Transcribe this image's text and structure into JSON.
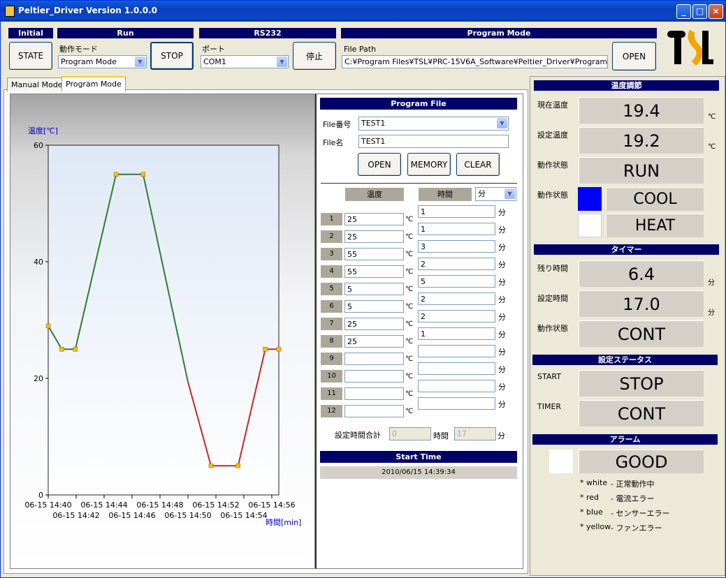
{
  "window": {
    "title": "Peltier_Driver Version 1.0.0.0",
    "min": "_",
    "max": "□",
    "close": "×"
  },
  "initial": {
    "header": "Initial",
    "state_btn": "STATE"
  },
  "run": {
    "header": "Run",
    "mode_label": "動作モード",
    "mode_value": "Program Mode",
    "stop_btn": "STOP"
  },
  "rs232": {
    "header": "RS232",
    "port_label": "ポート",
    "port_value": "COM1",
    "stop_btn": "停止"
  },
  "program_mode": {
    "header": "Program Mode",
    "file_path_label": "File Path",
    "file_path_value": "C:¥Program Files¥TSL¥PRC-15V6A_Software¥Peltier_Driver¥Program Mode",
    "open_btn": "OPEN"
  },
  "logo": "TSL",
  "tabs": [
    "Manual Mode",
    "Program Mode"
  ],
  "program_file": {
    "header": "Program File",
    "file_no_label": "File番号",
    "file_no_value": "TEST1",
    "file_name_label": "File名",
    "file_name_value": "TEST1",
    "open_btn": "OPEN",
    "memory_btn": "MEMORY",
    "clear_btn": "CLEAR",
    "temp_header": "温度",
    "time_header": "時間",
    "time_unit_select": "分",
    "temp_unit": "℃",
    "time_unit": "分",
    "rows": [
      {
        "no": "1",
        "temp": "25"
      },
      {
        "no": "2",
        "temp": "25"
      },
      {
        "no": "3",
        "temp": "55"
      },
      {
        "no": "4",
        "temp": "55"
      },
      {
        "no": "5",
        "temp": "5"
      },
      {
        "no": "6",
        "temp": "5"
      },
      {
        "no": "7",
        "temp": "25"
      },
      {
        "no": "8",
        "temp": "25"
      },
      {
        "no": "9",
        "temp": ""
      },
      {
        "no": "10",
        "temp": ""
      },
      {
        "no": "11",
        "temp": ""
      },
      {
        "no": "12",
        "temp": ""
      }
    ],
    "times": [
      "1",
      "1",
      "3",
      "2",
      "5",
      "2",
      "2",
      "1",
      "",
      "",
      "",
      ""
    ],
    "total_label": "設定時間合計",
    "total_hours": "0",
    "hours_unit": "時間",
    "total_minutes": "17",
    "minutes_unit": "分",
    "start_time_header": "Start Time",
    "start_time_value": "2010/06/15 14:39:34"
  },
  "temp_control": {
    "header": "温度調節",
    "current_label": "現在温度",
    "current_value": "19.4",
    "set_label": "設定温度",
    "set_value": "19.2",
    "unit": "℃",
    "status_label": "動作状態",
    "status_value": "RUN",
    "mode_label": "動作状態",
    "cool_label": "COOL",
    "heat_label": "HEAT",
    "cool_color": "#0000ff",
    "heat_color": "#ffffff"
  },
  "timer": {
    "header": "タイマー",
    "remaining_label": "残り時間",
    "remaining_value": "6.4",
    "set_label": "設定時間",
    "set_value": "17.0",
    "unit": "分",
    "status_label": "動作状態",
    "status_value": "CONT"
  },
  "set_status": {
    "header": "設定ステータス",
    "start_label": "START",
    "start_value": "STOP",
    "timer_label": "TIMER",
    "timer_value": "CONT"
  },
  "alarm": {
    "header": "アラーム",
    "value": "GOOD",
    "indicator_color": "#ffffff",
    "legend": [
      {
        "key": "* white",
        "desc": "- 正常動作中"
      },
      {
        "key": "* red",
        "desc": "- 電流エラー"
      },
      {
        "key": "* blue",
        "desc": "- センサーエラー"
      },
      {
        "key": "* yellow",
        "desc": "- ファンエラー"
      }
    ]
  },
  "chart_data": {
    "type": "line",
    "ylabel": "温度[℃]",
    "xlabel": "時間[min]",
    "ylim": [
      0,
      60
    ],
    "yticks": [
      "0",
      "20",
      "40",
      "60"
    ],
    "xticks_top": [
      "06-15 14:40",
      "06-15 14:44",
      "06-15 14:48",
      "06-15 14:52",
      "06-15 14:56"
    ],
    "xticks_bottom": [
      "06-15 14:42",
      "06-15 14:46",
      "06-15 14:50",
      "06-15 14:54"
    ],
    "xlim_min": [
      0,
      17
    ],
    "series": [
      {
        "color": "#2e7d32",
        "x": [
          0,
          1,
          2,
          5,
          7,
          10.3
        ],
        "y": [
          29,
          25,
          25,
          55,
          55,
          19.4
        ]
      },
      {
        "color": "#c62828",
        "x": [
          10.3,
          12,
          14,
          16,
          17
        ],
        "y": [
          19.4,
          5,
          5,
          25,
          25
        ]
      }
    ],
    "markers": {
      "color": "#f5c000",
      "x": [
        0,
        1,
        2,
        5,
        7,
        12,
        14,
        16,
        17
      ],
      "y": [
        29,
        25,
        25,
        55,
        55,
        5,
        5,
        25,
        25
      ]
    },
    "grid": false
  }
}
